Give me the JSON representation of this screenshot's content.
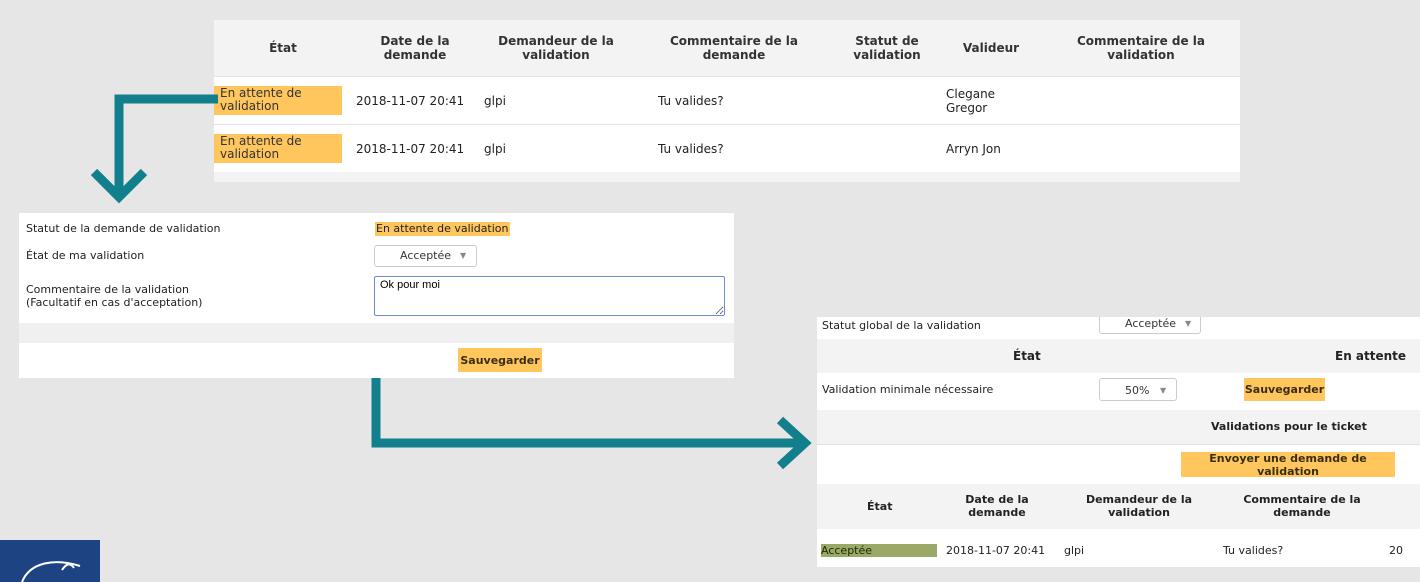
{
  "validations_table": {
    "headers": [
      "État",
      "Date de la demande",
      "Demandeur de la validation",
      "Commentaire de la demande",
      "Statut de validation",
      "Valideur",
      "Commentaire de la validation"
    ],
    "rows": [
      {
        "state": "En attente de validation",
        "date": "2018-11-07 20:41",
        "requester": "glpi",
        "comment": "Tu valides?",
        "status": "",
        "validator": "Clegane Gregor",
        "validation_comment": ""
      },
      {
        "state": "En attente de validation",
        "date": "2018-11-07 20:41",
        "requester": "glpi",
        "comment": "Tu valides?",
        "status": "",
        "validator": "Arryn Jon",
        "validation_comment": ""
      }
    ]
  },
  "my_validation_form": {
    "request_status_label": "Statut de la demande de validation",
    "request_status_value": "En attente de validation",
    "my_state_label": "État de ma validation",
    "my_state_value": "Acceptée",
    "comment_label_line1": "Commentaire de la validation",
    "comment_label_line2": "(Facultatif en cas d'acceptation)",
    "comment_value": "Ok pour moi",
    "save_label": "Sauvegarder"
  },
  "global_validation": {
    "global_status_label": "Statut global de la validation",
    "global_status_value": "Acceptée",
    "state_header": "État",
    "state_value_partial": "En attente",
    "min_validation_label": "Validation minimale nécessaire",
    "min_validation_value": "50%",
    "save_label": "Sauvegarder",
    "ticket_validations_title": "Validations pour le ticket",
    "send_request_label": "Envoyer une demande de validation",
    "headers": [
      "État",
      "Date de la demande",
      "Demandeur de la validation",
      "Commentaire de la demande"
    ],
    "row": {
      "state": "Acceptée",
      "date": "2018-11-07 20:41",
      "requester": "glpi",
      "comment": "Tu valides?",
      "next_partial": "20"
    }
  },
  "colors": {
    "pending": "#ffc65d",
    "accepted": "#9aa968",
    "arrow": "#127f8c",
    "background": "#e5e6e5",
    "logo": "#1d4383"
  }
}
